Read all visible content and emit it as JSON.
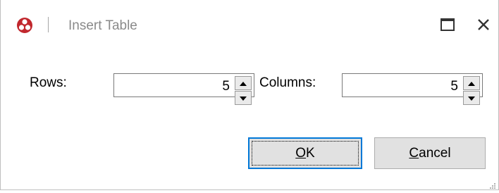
{
  "window": {
    "title": "Insert Table",
    "icon": "app-logo-icon",
    "controls": {
      "maximize": "maximize-icon",
      "close": "close-icon"
    }
  },
  "form": {
    "rows_label": "Rows:",
    "rows_value": "5",
    "columns_label": "Columns:",
    "columns_value": "5"
  },
  "buttons": {
    "ok": {
      "mnemonic": "O",
      "rest": "K"
    },
    "cancel": {
      "mnemonic": "C",
      "rest": "ancel"
    }
  },
  "colors": {
    "accent": "#0078d7",
    "logo_red": "#c1272d",
    "button_face": "#e1e1e1"
  }
}
